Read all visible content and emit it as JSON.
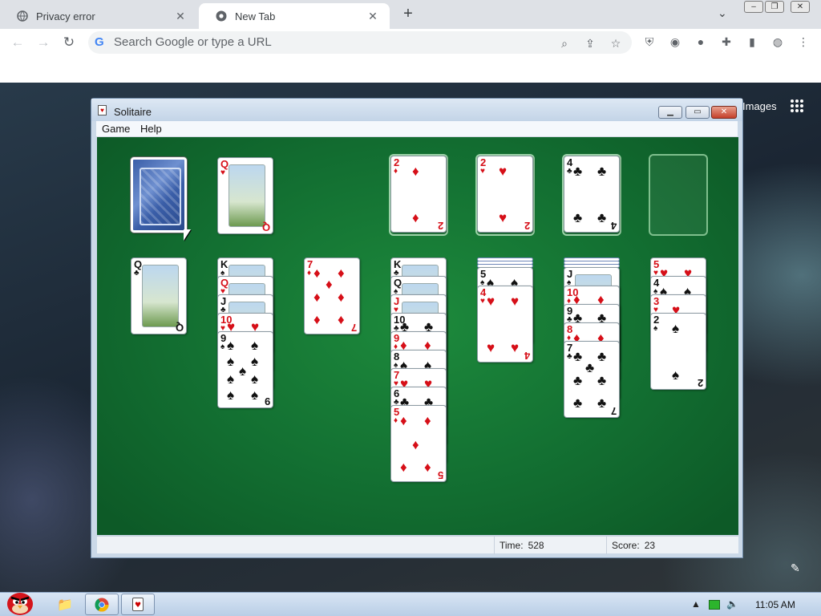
{
  "browser": {
    "tabs": [
      {
        "label": "Privacy error",
        "active": false
      },
      {
        "label": "New Tab",
        "active": true
      }
    ],
    "omnibox_placeholder": "Search Google or type a URL",
    "images_link": "Images"
  },
  "solitaire": {
    "title": "Solitaire",
    "menu": [
      "Game",
      "Help"
    ],
    "status": {
      "time_label": "Time:",
      "time_value": "528",
      "score_label": "Score:",
      "score_value": "23"
    },
    "stock": {
      "face_down": true
    },
    "waste": [
      {
        "rank": "Q",
        "suit": "hearts",
        "picture": "flowers"
      }
    ],
    "foundations": [
      {
        "rank": "2",
        "suit": "diamonds"
      },
      {
        "rank": "2",
        "suit": "hearts"
      },
      {
        "rank": "4",
        "suit": "clubs"
      },
      {
        "rank": "",
        "suit": ""
      }
    ],
    "tableau": [
      {
        "hidden": 0,
        "cards": [
          {
            "rank": "Q",
            "suit": "clubs"
          }
        ]
      },
      {
        "hidden": 0,
        "cards": [
          {
            "rank": "K",
            "suit": "spades"
          },
          {
            "rank": "Q",
            "suit": "hearts"
          },
          {
            "rank": "J",
            "suit": "clubs"
          },
          {
            "rank": "10",
            "suit": "hearts"
          },
          {
            "rank": "9",
            "suit": "spades"
          }
        ]
      },
      {
        "hidden": 0,
        "cards": [
          {
            "rank": "7",
            "suit": "diamonds"
          }
        ]
      },
      {
        "hidden": 0,
        "cards": [
          {
            "rank": "K",
            "suit": "clubs"
          },
          {
            "rank": "Q",
            "suit": "spades"
          },
          {
            "rank": "J",
            "suit": "hearts"
          },
          {
            "rank": "10",
            "suit": "clubs"
          },
          {
            "rank": "9",
            "suit": "diamonds"
          },
          {
            "rank": "8",
            "suit": "spades"
          },
          {
            "rank": "7",
            "suit": "hearts"
          },
          {
            "rank": "6",
            "suit": "clubs"
          },
          {
            "rank": "5",
            "suit": "diamonds"
          }
        ]
      },
      {
        "hidden": 3,
        "cards": [
          {
            "rank": "5",
            "suit": "spades"
          },
          {
            "rank": "4",
            "suit": "hearts"
          }
        ]
      },
      {
        "hidden": 3,
        "cards": [
          {
            "rank": "J",
            "suit": "spades"
          },
          {
            "rank": "10",
            "suit": "diamonds"
          },
          {
            "rank": "9",
            "suit": "clubs"
          },
          {
            "rank": "8",
            "suit": "diamonds"
          },
          {
            "rank": "7",
            "suit": "clubs"
          }
        ]
      },
      {
        "hidden": 0,
        "cards": [
          {
            "rank": "5",
            "suit": "hearts"
          },
          {
            "rank": "4",
            "suit": "spades"
          },
          {
            "rank": "3",
            "suit": "hearts"
          },
          {
            "rank": "2",
            "suit": "spades"
          }
        ]
      }
    ]
  },
  "taskbar": {
    "clock": "11:05 AM"
  },
  "colors": {
    "felt": "#137032",
    "red_suit": "#d60f18",
    "black_suit": "#111111"
  }
}
